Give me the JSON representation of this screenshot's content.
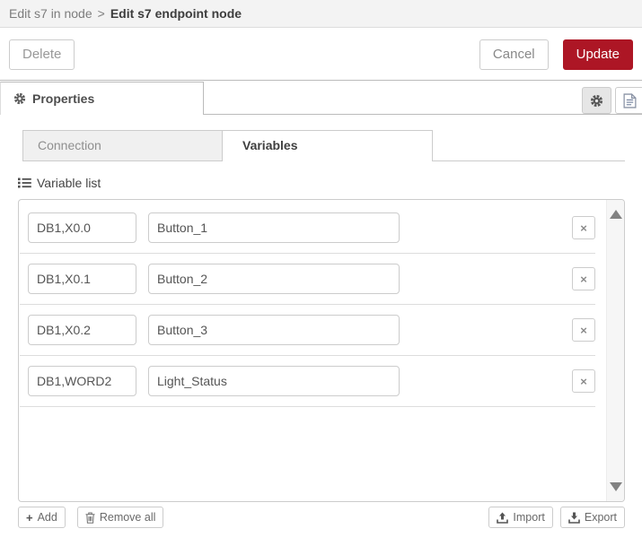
{
  "header": {
    "breadcrumb_parent": "Edit s7 in node",
    "breadcrumb_separator": ">",
    "breadcrumb_current": "Edit s7 endpoint node"
  },
  "actionbar": {
    "delete_label": "Delete",
    "cancel_label": "Cancel",
    "update_label": "Update"
  },
  "editor_tabs": {
    "properties_label": "Properties"
  },
  "sub_tabs": {
    "connection_label": "Connection",
    "variables_label": "Variables",
    "active_tab": "Variables"
  },
  "variable_list": {
    "title": "Variable list",
    "rows": [
      {
        "address": "DB1,X0.0",
        "name": "Button_1"
      },
      {
        "address": "DB1,X0.1",
        "name": "Button_2"
      },
      {
        "address": "DB1,X0.2",
        "name": "Button_3"
      },
      {
        "address": "DB1,WORD2",
        "name": "Light_Status"
      }
    ]
  },
  "list_footer": {
    "add_label": "Add",
    "remove_all_label": "Remove all",
    "import_label": "Import",
    "export_label": "Export"
  },
  "icons": {
    "close_glyph": "×",
    "plus_glyph": "+"
  },
  "colors": {
    "accent_red": "#AD1625",
    "header_bg": "#f3f3f3",
    "inactive_tab_bg": "#f0f0f0",
    "border": "#cccccc"
  }
}
